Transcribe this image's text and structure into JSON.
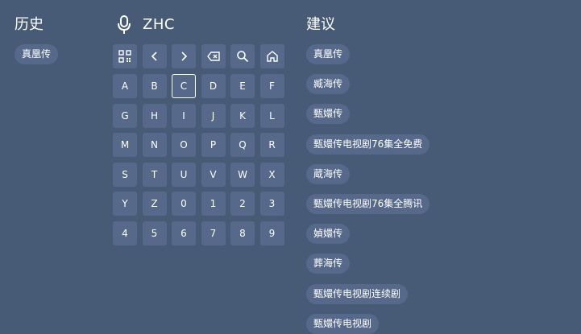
{
  "history": {
    "title": "历史",
    "items": [
      "真凰传"
    ]
  },
  "search": {
    "query": "ZHC",
    "mic_icon": "microphone-icon",
    "tool_keys": [
      {
        "name": "qr-code-icon"
      },
      {
        "name": "chevron-left-icon"
      },
      {
        "name": "chevron-right-icon"
      },
      {
        "name": "backspace-icon"
      },
      {
        "name": "search-icon"
      },
      {
        "name": "home-icon"
      }
    ],
    "keys": [
      [
        "A",
        "B",
        "C",
        "D",
        "E",
        "F"
      ],
      [
        "G",
        "H",
        "I",
        "J",
        "K",
        "L"
      ],
      [
        "M",
        "N",
        "O",
        "P",
        "Q",
        "R"
      ],
      [
        "S",
        "T",
        "U",
        "V",
        "W",
        "X"
      ],
      [
        "Y",
        "Z",
        "0",
        "1",
        "2",
        "3"
      ],
      [
        "4",
        "5",
        "6",
        "7",
        "8",
        "9"
      ]
    ],
    "selected_key": "C"
  },
  "suggestions": {
    "title": "建议",
    "items": [
      "真凰传",
      "臧海传",
      "甄嬛传",
      "甄嬛传电视剧76集全免费",
      "蔵海传",
      "甄嬛传电视剧76集全腾讯",
      "媜嬛传",
      "葬海传",
      "甄嬛传电视剧连续剧",
      "甄嬛传电视剧"
    ]
  }
}
